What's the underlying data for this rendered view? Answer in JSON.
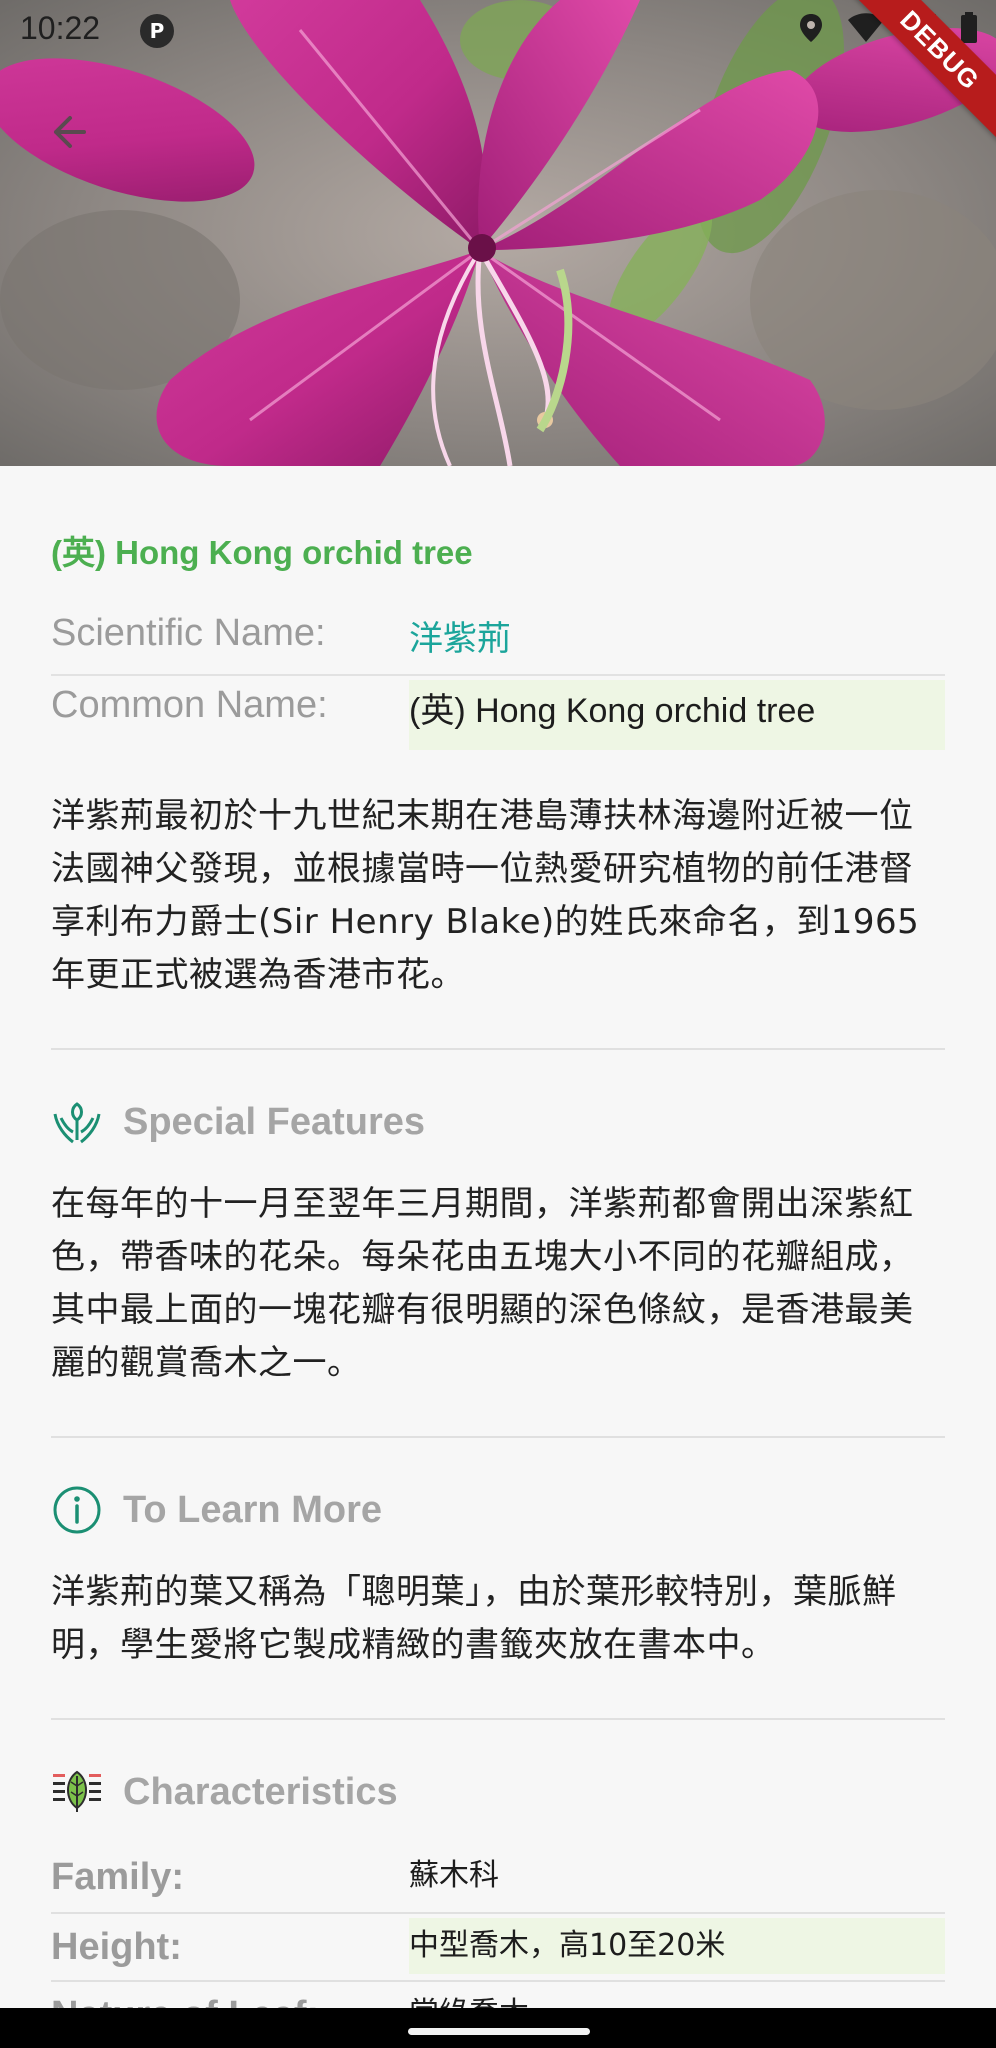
{
  "status_bar": {
    "time": "10:22",
    "app_badge": "P",
    "icons": [
      "location-icon",
      "wifi-icon",
      "signal-icon",
      "battery-icon"
    ]
  },
  "debug_banner": "DEBUG",
  "header": {
    "back_icon": "arrow-left-icon"
  },
  "plant": {
    "en_title": "(英) Hong Kong orchid tree",
    "scientific_name_label": "Scientific Name:",
    "scientific_name_value": "洋紫荊",
    "common_name_label": "Common Name:",
    "common_name_value": "(英) Hong Kong orchid tree",
    "description": "洋紫荊最初於十九世紀末期在港島薄扶林海邊附近被一位法國神父發現，並根據當時一位熱愛研究植物的前任港督享利布力爵士(Sir Henry Blake)的姓氏來命名，到1965年更正式被選為香港市花。"
  },
  "sections": {
    "special_features": {
      "icon": "hands-sprout-icon",
      "title": "Special Features",
      "body": "在每年的十一月至翌年三月期間，洋紫荊都會開出深紫紅色，帶香味的花朵。每朵花由五塊大小不同的花瓣組成，其中最上面的一塊花瓣有很明顯的深色條紋，是香港最美麗的觀賞喬木之一。"
    },
    "learn_more": {
      "icon": "info-icon",
      "title": "To Learn More",
      "body": "洋紫荊的葉又稱為「聰明葉」，由於葉形較特別，葉脈鮮明，學生愛將它製成精緻的書籤夾放在書本中。"
    },
    "characteristics": {
      "icon": "leaf-bookmark-icon",
      "title": "Characteristics",
      "rows": [
        {
          "label": "Family:",
          "value": "蘇木科"
        },
        {
          "label": "Height:",
          "value": "中型喬木，高10至20米"
        },
        {
          "label": "Nature of Leaf:",
          "value": "常綠喬木"
        }
      ]
    }
  },
  "colors": {
    "title_green": "#4caf50",
    "scientific_teal": "#1ba59b",
    "label_gray": "#9b9b9b",
    "highlight_bg": "#eef6e4",
    "debug_red": "#b71c1c"
  }
}
